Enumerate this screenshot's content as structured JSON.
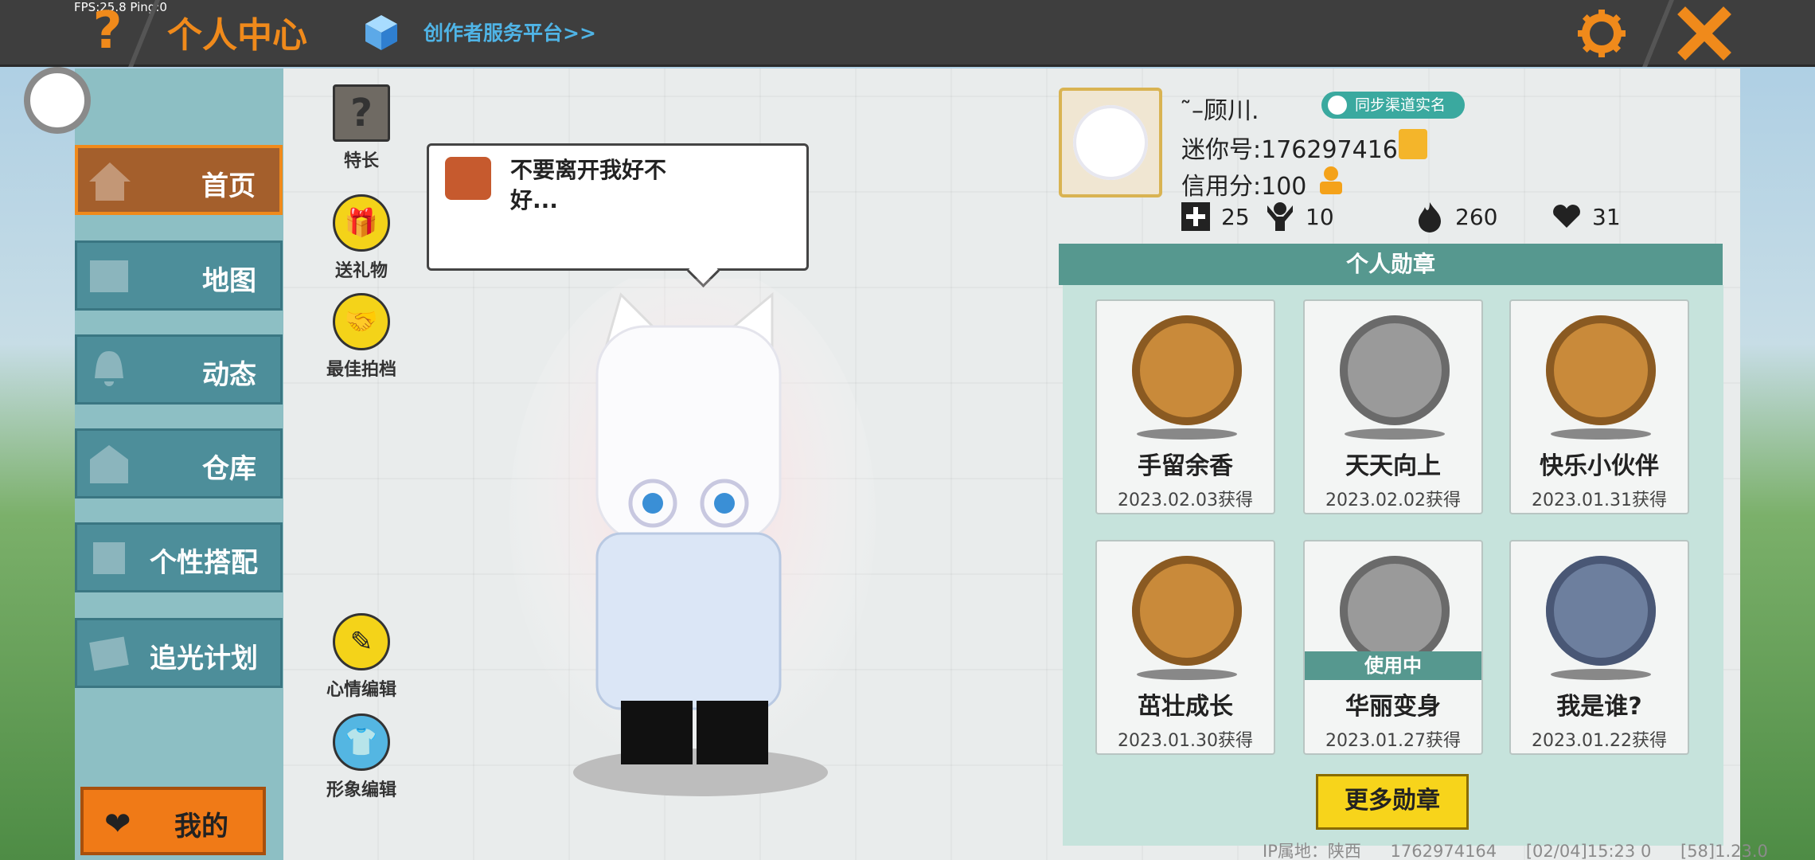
{
  "status": {
    "fps": "FPS:25.8  Ping:0"
  },
  "header": {
    "help_glyph": "?",
    "title": "个人中心",
    "creator_link": "创作者服务平台>>",
    "settings_icon": "gear-icon",
    "close_icon": "close-icon",
    "accent": "#f08a1b"
  },
  "sidebar": {
    "items": [
      {
        "label": "首页",
        "active": true
      },
      {
        "label": "地图"
      },
      {
        "label": "动态"
      },
      {
        "label": "仓库"
      },
      {
        "label": "个性搭配"
      },
      {
        "label": "追光计划"
      }
    ],
    "mine_label": "我的"
  },
  "actions": [
    {
      "label": "特长",
      "icon": "question-box-icon",
      "glyph": "?"
    },
    {
      "label": "送礼物",
      "icon": "gift-icon",
      "glyph": "🎁"
    },
    {
      "label": "最佳拍档",
      "icon": "handshake-icon",
      "glyph": "🤝"
    },
    {
      "label": "心情编辑",
      "icon": "edit-icon",
      "glyph": "✎"
    },
    {
      "label": "形象编辑",
      "icon": "outfit-icon",
      "glyph": "👕"
    }
  ],
  "speech": {
    "text": "不要离开我好不好..."
  },
  "profile": {
    "name": "˜–顾川.",
    "realname_badge": "同步渠道实名",
    "mini_id": "迷你号:1762974164",
    "credit": "信用分:100",
    "stats": [
      {
        "icon": "add-friend-icon",
        "value": "25"
      },
      {
        "icon": "fans-icon",
        "value": "10"
      },
      {
        "icon": "fire-icon",
        "value": "260"
      },
      {
        "icon": "hearts-icon",
        "value": "31"
      }
    ]
  },
  "medals": {
    "title": "个人勋章",
    "items": [
      {
        "name": "手留余香",
        "date": "2023.02.03获得",
        "color": "#c98a3a"
      },
      {
        "name": "天天向上",
        "date": "2023.02.02获得",
        "color": "#9a9a9a"
      },
      {
        "name": "快乐小伙伴",
        "date": "2023.01.31获得",
        "color": "#c98a3a"
      },
      {
        "name": "茁壮成长",
        "date": "2023.01.30获得",
        "color": "#c98a3a"
      },
      {
        "name": "华丽变身",
        "date": "2023.01.27获得",
        "color": "#9a9a9a",
        "in_use": "使用中"
      },
      {
        "name": "我是谁?",
        "date": "2023.01.22获得",
        "color": "#6d7f9e"
      }
    ],
    "more_button": "更多勋章"
  },
  "footer": {
    "ip": "IP属地：陕西",
    "uid": "1762974164",
    "time": "[02/04]15:23 0",
    "version": "[58]1.23.0"
  }
}
